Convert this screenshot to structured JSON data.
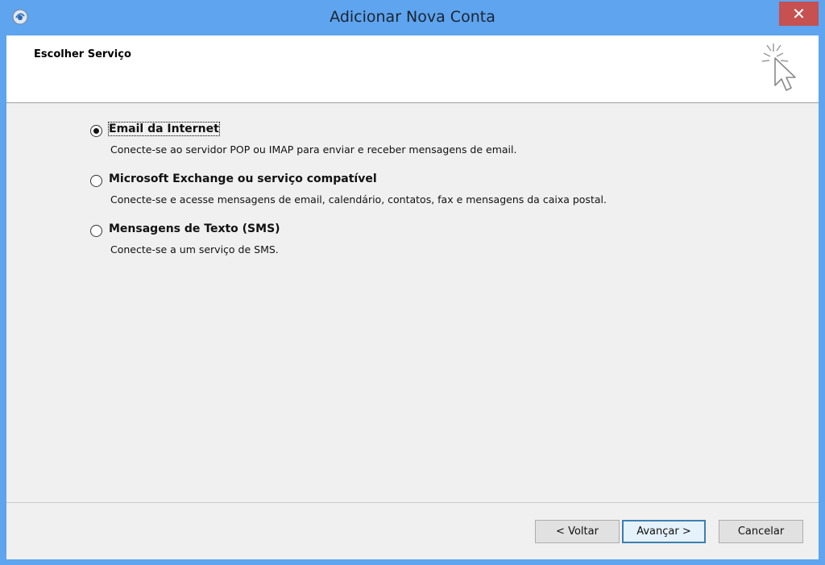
{
  "window": {
    "title": "Adicionar Nova Conta",
    "close_glyph": "✕",
    "icon": "outlook-app-icon"
  },
  "header": {
    "title": "Escolher Serviço",
    "icon": "cursor-sparkle-icon"
  },
  "options": [
    {
      "label": "Email da Internet",
      "description": "Conecte-se ao servidor POP ou IMAP para enviar e receber mensagens de email.",
      "selected": true
    },
    {
      "label": "Microsoft Exchange ou serviço compatível",
      "description": "Conecte-se e acesse mensagens de email, calendário, contatos, fax e mensagens da caixa postal.",
      "selected": false
    },
    {
      "label": "Mensagens de Texto (SMS)",
      "description": "Conecte-se a um serviço de SMS.",
      "selected": false
    }
  ],
  "buttons": {
    "back": "< Voltar",
    "next": "Avançar >",
    "cancel": "Cancelar"
  },
  "colors": {
    "frame": "#5ea4ee",
    "close": "#c75050",
    "client": "#f0f0f0"
  }
}
